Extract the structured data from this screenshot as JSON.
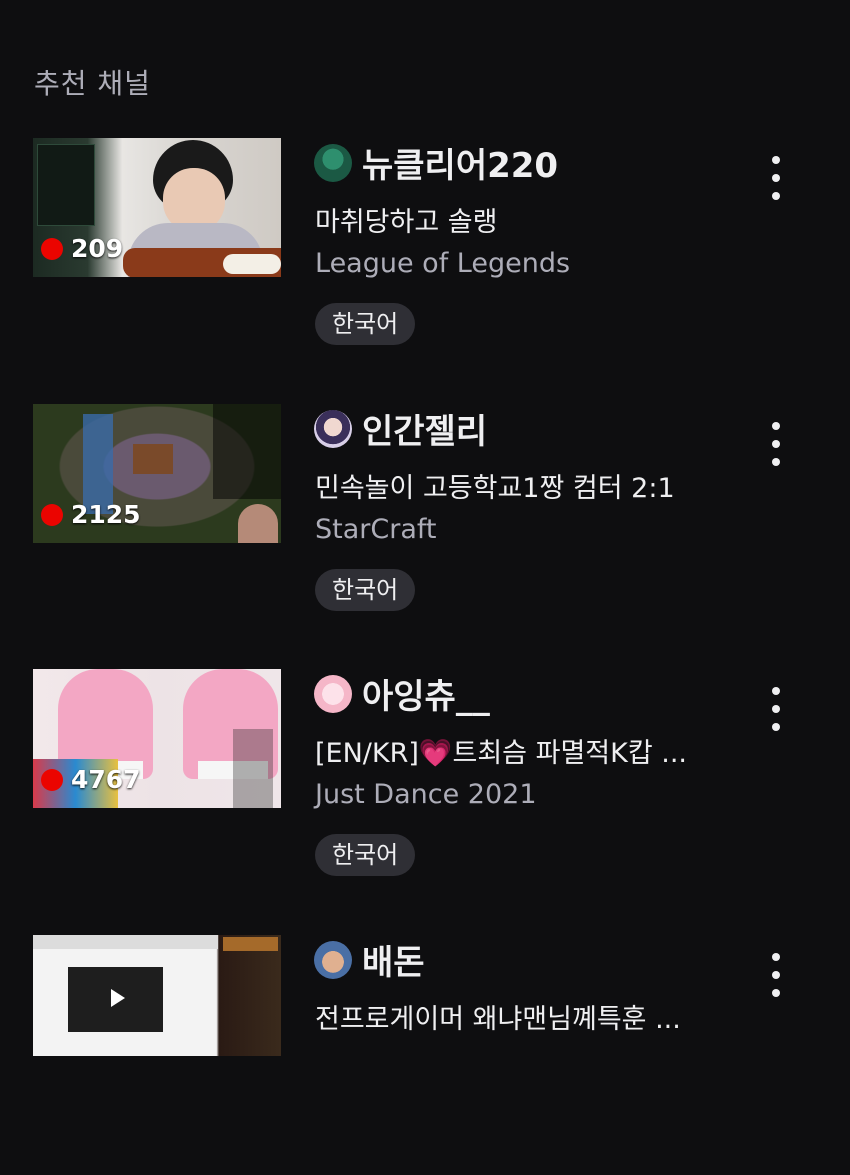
{
  "section": {
    "title": "추천 채널"
  },
  "channels": [
    {
      "viewers": "209",
      "name": "뉴클리어220",
      "title": "마취당하고 솔랭",
      "game": "League of Legends",
      "tag": "한국어",
      "avatar_icon": "avatar-icon"
    },
    {
      "viewers": "2125",
      "name": "인간젤리",
      "title": "민속놀이 고등학교1짱 컴터 2:1",
      "game": "StarCraft",
      "tag": "한국어",
      "avatar_icon": "avatar-icon"
    },
    {
      "viewers": "4767",
      "name": "아잉츄__",
      "title": "[EN/KR]💗트최슴 파멸적K캅 ...",
      "game": "Just Dance 2021",
      "tag": "한국어",
      "avatar_icon": "avatar-icon"
    },
    {
      "viewers": "",
      "name": "배돈",
      "title": "전프로게이머 왜냐맨님꼐특훈 ...",
      "game": "",
      "tag": "",
      "avatar_icon": "avatar-icon"
    }
  ],
  "colors": {
    "background": "#0e0e10",
    "live": "#eb0400",
    "tag_bg": "#2f2f35",
    "muted_text": "#adadb8"
  },
  "icons": [
    "live-dot-icon",
    "more-options-icon",
    "avatar-icon"
  ]
}
